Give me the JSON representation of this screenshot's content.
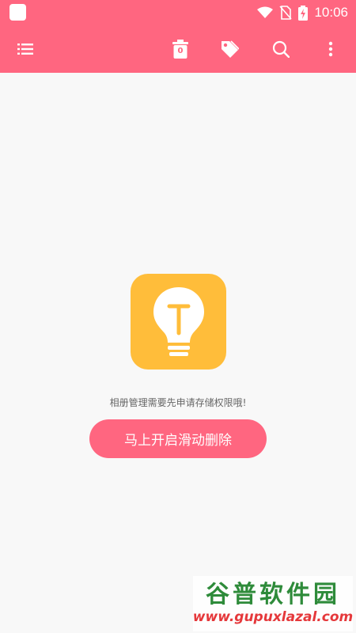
{
  "status_bar": {
    "time": "10:06",
    "icons": [
      "app-icon",
      "wifi-icon",
      "no-sim-icon",
      "battery-charging-icon"
    ]
  },
  "toolbar": {
    "icons": [
      "menu-list-icon",
      "trash-icon",
      "tag-icon",
      "search-icon",
      "more-vert-icon"
    ],
    "trash_count": "0"
  },
  "main": {
    "illustration_icon": "lightbulb-icon",
    "message": "相册管理需要先申请存储权限哦!",
    "action_label": "马上开启滑动删除"
  },
  "watermark": {
    "title": "谷普软件园",
    "url": "www.gupuxlazal.com"
  },
  "colors": {
    "accent": "#ff6680",
    "tile": "#ffbd3a",
    "background": "#f8f8f8"
  }
}
